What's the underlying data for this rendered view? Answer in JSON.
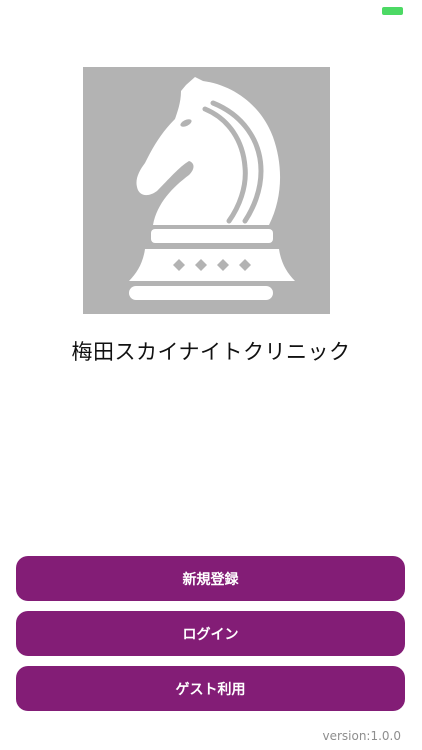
{
  "status_bar": {
    "battery_color": "#4cd964"
  },
  "logo": {
    "icon": "chess-knight-icon",
    "background_color": "#b3b3b3",
    "icon_color": "#ffffff"
  },
  "clinic": {
    "name": "梅田スカイナイトクリニック"
  },
  "buttons": {
    "register_label": "新規登録",
    "login_label": "ログイン",
    "guest_label": "ゲスト利用",
    "color": "#831d76"
  },
  "footer": {
    "version": "version:1.0.0"
  }
}
